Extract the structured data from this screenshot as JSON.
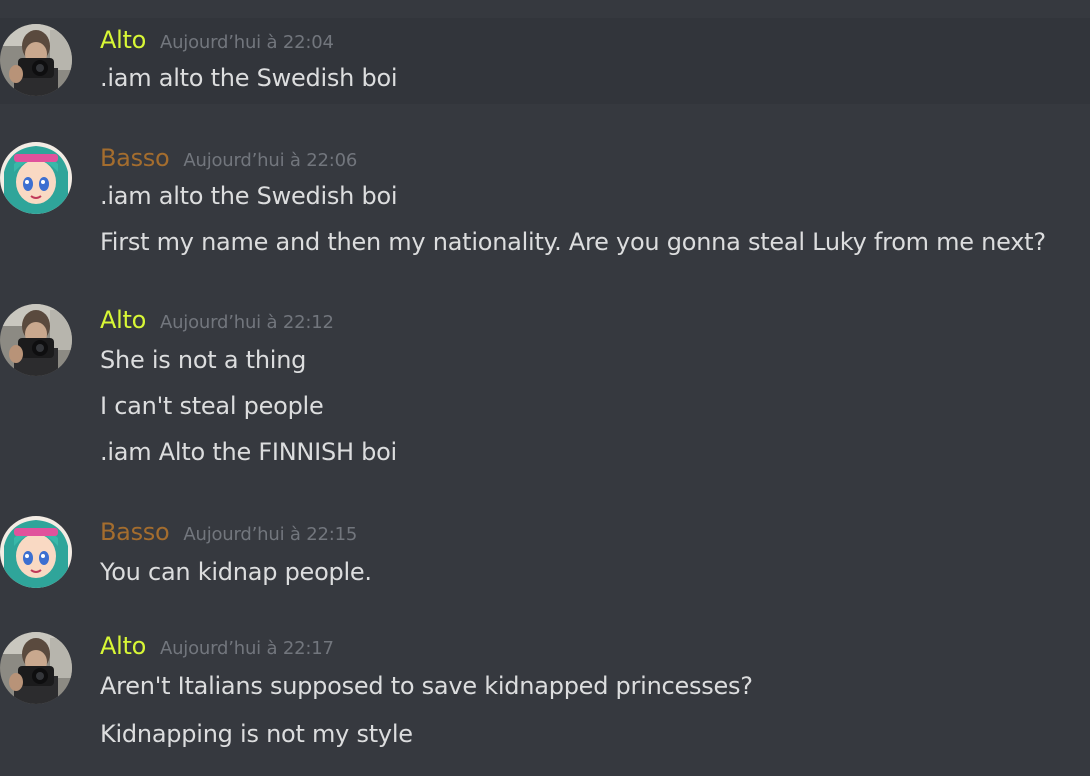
{
  "colors": {
    "background": "#36393f",
    "hover_background": "#32353b",
    "alto_name": "#d8f736",
    "basso_name": "#a46d2e",
    "timestamp": "#72767d",
    "message_text": "#dcddde"
  },
  "messages": [
    {
      "author": "Alto",
      "avatar_icon": "user-avatar-camera-icon",
      "timestamp": "Aujourd’hui à 22:04",
      "lines": [
        ".iam alto the Swedish boi"
      ]
    },
    {
      "author": "Basso",
      "avatar_icon": "user-avatar-anime-girl-icon",
      "timestamp": "Aujourd’hui à 22:06",
      "lines": [
        ".iam alto the Swedish boi",
        "First my name and then my nationality. Are you gonna steal Luky from me next?"
      ]
    },
    {
      "author": "Alto",
      "avatar_icon": "user-avatar-camera-icon",
      "timestamp": "Aujourd’hui à 22:12",
      "lines": [
        "She is not a thing",
        "I can't steal people",
        ".iam Alto the FINNISH boi"
      ]
    },
    {
      "author": "Basso",
      "avatar_icon": "user-avatar-anime-girl-icon",
      "timestamp": "Aujourd’hui à 22:15",
      "lines": [
        "You can kidnap people."
      ]
    },
    {
      "author": "Alto",
      "avatar_icon": "user-avatar-camera-icon",
      "timestamp": "Aujourd’hui à 22:17",
      "lines": [
        "Aren't Italians supposed to save kidnapped princesses?",
        "Kidnapping is not my style"
      ]
    }
  ]
}
